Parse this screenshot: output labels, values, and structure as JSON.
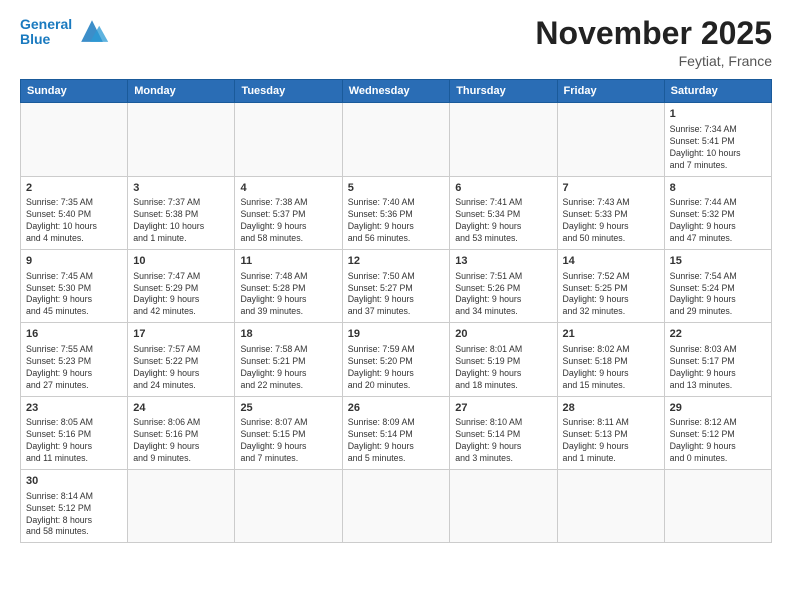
{
  "header": {
    "logo_general": "General",
    "logo_blue": "Blue",
    "month": "November 2025",
    "location": "Feytiat, France"
  },
  "weekdays": [
    "Sunday",
    "Monday",
    "Tuesday",
    "Wednesday",
    "Thursday",
    "Friday",
    "Saturday"
  ],
  "weeks": [
    [
      {
        "day": "",
        "info": ""
      },
      {
        "day": "",
        "info": ""
      },
      {
        "day": "",
        "info": ""
      },
      {
        "day": "",
        "info": ""
      },
      {
        "day": "",
        "info": ""
      },
      {
        "day": "",
        "info": ""
      },
      {
        "day": "1",
        "info": "Sunrise: 7:34 AM\nSunset: 5:41 PM\nDaylight: 10 hours\nand 7 minutes."
      }
    ],
    [
      {
        "day": "2",
        "info": "Sunrise: 7:35 AM\nSunset: 5:40 PM\nDaylight: 10 hours\nand 4 minutes."
      },
      {
        "day": "3",
        "info": "Sunrise: 7:37 AM\nSunset: 5:38 PM\nDaylight: 10 hours\nand 1 minute."
      },
      {
        "day": "4",
        "info": "Sunrise: 7:38 AM\nSunset: 5:37 PM\nDaylight: 9 hours\nand 58 minutes."
      },
      {
        "day": "5",
        "info": "Sunrise: 7:40 AM\nSunset: 5:36 PM\nDaylight: 9 hours\nand 56 minutes."
      },
      {
        "day": "6",
        "info": "Sunrise: 7:41 AM\nSunset: 5:34 PM\nDaylight: 9 hours\nand 53 minutes."
      },
      {
        "day": "7",
        "info": "Sunrise: 7:43 AM\nSunset: 5:33 PM\nDaylight: 9 hours\nand 50 minutes."
      },
      {
        "day": "8",
        "info": "Sunrise: 7:44 AM\nSunset: 5:32 PM\nDaylight: 9 hours\nand 47 minutes."
      }
    ],
    [
      {
        "day": "9",
        "info": "Sunrise: 7:45 AM\nSunset: 5:30 PM\nDaylight: 9 hours\nand 45 minutes."
      },
      {
        "day": "10",
        "info": "Sunrise: 7:47 AM\nSunset: 5:29 PM\nDaylight: 9 hours\nand 42 minutes."
      },
      {
        "day": "11",
        "info": "Sunrise: 7:48 AM\nSunset: 5:28 PM\nDaylight: 9 hours\nand 39 minutes."
      },
      {
        "day": "12",
        "info": "Sunrise: 7:50 AM\nSunset: 5:27 PM\nDaylight: 9 hours\nand 37 minutes."
      },
      {
        "day": "13",
        "info": "Sunrise: 7:51 AM\nSunset: 5:26 PM\nDaylight: 9 hours\nand 34 minutes."
      },
      {
        "day": "14",
        "info": "Sunrise: 7:52 AM\nSunset: 5:25 PM\nDaylight: 9 hours\nand 32 minutes."
      },
      {
        "day": "15",
        "info": "Sunrise: 7:54 AM\nSunset: 5:24 PM\nDaylight: 9 hours\nand 29 minutes."
      }
    ],
    [
      {
        "day": "16",
        "info": "Sunrise: 7:55 AM\nSunset: 5:23 PM\nDaylight: 9 hours\nand 27 minutes."
      },
      {
        "day": "17",
        "info": "Sunrise: 7:57 AM\nSunset: 5:22 PM\nDaylight: 9 hours\nand 24 minutes."
      },
      {
        "day": "18",
        "info": "Sunrise: 7:58 AM\nSunset: 5:21 PM\nDaylight: 9 hours\nand 22 minutes."
      },
      {
        "day": "19",
        "info": "Sunrise: 7:59 AM\nSunset: 5:20 PM\nDaylight: 9 hours\nand 20 minutes."
      },
      {
        "day": "20",
        "info": "Sunrise: 8:01 AM\nSunset: 5:19 PM\nDaylight: 9 hours\nand 18 minutes."
      },
      {
        "day": "21",
        "info": "Sunrise: 8:02 AM\nSunset: 5:18 PM\nDaylight: 9 hours\nand 15 minutes."
      },
      {
        "day": "22",
        "info": "Sunrise: 8:03 AM\nSunset: 5:17 PM\nDaylight: 9 hours\nand 13 minutes."
      }
    ],
    [
      {
        "day": "23",
        "info": "Sunrise: 8:05 AM\nSunset: 5:16 PM\nDaylight: 9 hours\nand 11 minutes."
      },
      {
        "day": "24",
        "info": "Sunrise: 8:06 AM\nSunset: 5:16 PM\nDaylight: 9 hours\nand 9 minutes."
      },
      {
        "day": "25",
        "info": "Sunrise: 8:07 AM\nSunset: 5:15 PM\nDaylight: 9 hours\nand 7 minutes."
      },
      {
        "day": "26",
        "info": "Sunrise: 8:09 AM\nSunset: 5:14 PM\nDaylight: 9 hours\nand 5 minutes."
      },
      {
        "day": "27",
        "info": "Sunrise: 8:10 AM\nSunset: 5:14 PM\nDaylight: 9 hours\nand 3 minutes."
      },
      {
        "day": "28",
        "info": "Sunrise: 8:11 AM\nSunset: 5:13 PM\nDaylight: 9 hours\nand 1 minute."
      },
      {
        "day": "29",
        "info": "Sunrise: 8:12 AM\nSunset: 5:12 PM\nDaylight: 9 hours\nand 0 minutes."
      }
    ],
    [
      {
        "day": "30",
        "info": "Sunrise: 8:14 AM\nSunset: 5:12 PM\nDaylight: 8 hours\nand 58 minutes."
      },
      {
        "day": "",
        "info": ""
      },
      {
        "day": "",
        "info": ""
      },
      {
        "day": "",
        "info": ""
      },
      {
        "day": "",
        "info": ""
      },
      {
        "day": "",
        "info": ""
      },
      {
        "day": "",
        "info": ""
      }
    ]
  ]
}
